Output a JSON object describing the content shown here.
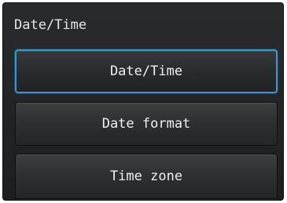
{
  "screen": {
    "title": "Date/Time"
  },
  "menu": {
    "items": [
      {
        "label": "Date/Time",
        "selected": true
      },
      {
        "label": "Date format",
        "selected": false
      },
      {
        "label": "Time zone",
        "selected": false
      }
    ]
  },
  "colors": {
    "background": "#232425",
    "button": "#303133",
    "selection_border": "#3e93c9",
    "text": "#f0f0f0"
  }
}
